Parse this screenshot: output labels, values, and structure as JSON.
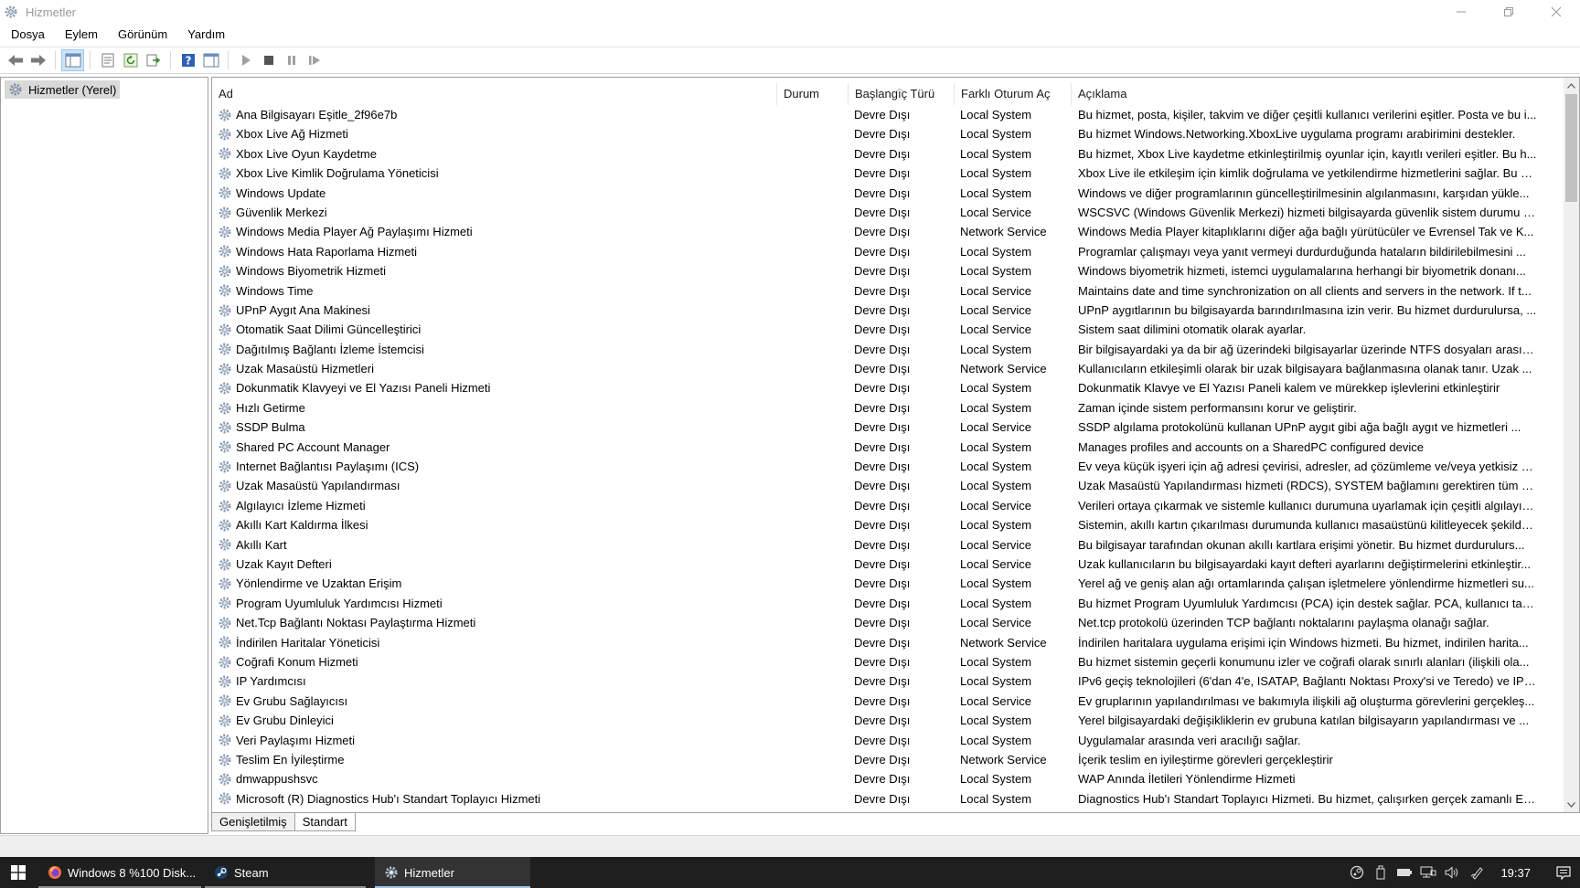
{
  "window": {
    "title": "Hizmetler"
  },
  "menu": [
    "Dosya",
    "Eylem",
    "Görünüm",
    "Yardım"
  ],
  "toolbar_icons": [
    "back-arrow-icon",
    "forward-arrow-icon",
    "console-tree-icon",
    "properties-icon",
    "refresh-icon",
    "export-list-icon",
    "help-icon",
    "show-hide-pane-icon",
    "start-service-icon",
    "stop-service-icon",
    "pause-service-icon",
    "restart-service-icon"
  ],
  "tree": {
    "root_label": "Hizmetler (Yerel)"
  },
  "columns": {
    "name": "Ad",
    "status": "Durum",
    "startup": "Başlangıç Türü",
    "logon": "Farklı Oturum Aç",
    "description": "Açıklama"
  },
  "services": [
    {
      "name": "Ana Bilgisayarı Eşitle_2f96e7b",
      "status": "",
      "startup": "Devre Dışı",
      "logon": "Local System",
      "description": "Bu hizmet, posta, kişiler, takvim ve diğer çeşitli kullanıcı verilerini eşitler. Posta ve bu i..."
    },
    {
      "name": "Xbox Live Ağ Hizmeti",
      "status": "",
      "startup": "Devre Dışı",
      "logon": "Local System",
      "description": "Bu hizmet Windows.Networking.XboxLive uygulama programı arabirimini destekler."
    },
    {
      "name": "Xbox Live Oyun Kaydetme",
      "status": "",
      "startup": "Devre Dışı",
      "logon": "Local System",
      "description": "Bu hizmet, Xbox Live kaydetme etkinleştirilmiş oyunlar için, kayıtlı verileri eşitler. Bu h..."
    },
    {
      "name": "Xbox Live Kimlik Doğrulama Yöneticisi",
      "status": "",
      "startup": "Devre Dışı",
      "logon": "Local System",
      "description": "Xbox Live ile etkileşim için kimlik doğrulama ve yetkilendirme hizmetlerini sağlar. Bu h..."
    },
    {
      "name": "Windows Update",
      "status": "",
      "startup": "Devre Dışı",
      "logon": "Local System",
      "description": "Windows ve diğer programlarının güncelleştirilmesinin algılanmasını, karşıdan yükle..."
    },
    {
      "name": "Güvenlik Merkezi",
      "status": "",
      "startup": "Devre Dışı",
      "logon": "Local Service",
      "description": "WSCSVC (Windows Güvenlik Merkezi) hizmeti bilgisayarda güvenlik sistem durumu a..."
    },
    {
      "name": "Windows Media Player Ağ Paylaşımı Hizmeti",
      "status": "",
      "startup": "Devre Dışı",
      "logon": "Network Service",
      "description": "Windows Media Player kitaplıklarını diğer ağa bağlı yürütücüler ve Evrensel Tak ve K..."
    },
    {
      "name": "Windows Hata Raporlama Hizmeti",
      "status": "",
      "startup": "Devre Dışı",
      "logon": "Local System",
      "description": "Programlar çalışmayı veya yanıt vermeyi durdurduğunda hataların bildirilebilmesini ..."
    },
    {
      "name": "Windows Biyometrik Hizmeti",
      "status": "",
      "startup": "Devre Dışı",
      "logon": "Local System",
      "description": "Windows biyometrik hizmeti, istemci uygulamalarına herhangi bir biyometrik donanı..."
    },
    {
      "name": "Windows Time",
      "status": "",
      "startup": "Devre Dışı",
      "logon": "Local Service",
      "description": "Maintains date and time synchronization on all clients and servers in the network. If t..."
    },
    {
      "name": "UPnP Aygıt Ana Makinesi",
      "status": "",
      "startup": "Devre Dışı",
      "logon": "Local Service",
      "description": "UPnP aygıtlarının bu bilgisayarda barındırılmasına izin verir. Bu hizmet durdurulursa, ..."
    },
    {
      "name": "Otomatik Saat Dilimi Güncelleştirici",
      "status": "",
      "startup": "Devre Dışı",
      "logon": "Local Service",
      "description": "Sistem saat dilimini otomatik olarak ayarlar."
    },
    {
      "name": "Dağıtılmış Bağlantı İzleme İstemcisi",
      "status": "",
      "startup": "Devre Dışı",
      "logon": "Local System",
      "description": "Bir bilgisayardaki ya da bir ağ üzerindeki bilgisayarlar üzerinde NTFS dosyaları arasın..."
    },
    {
      "name": "Uzak Masaüstü Hizmetleri",
      "status": "",
      "startup": "Devre Dışı",
      "logon": "Network Service",
      "description": "Kullanıcıların etkileşimli olarak bir uzak bilgisayara bağlanmasına olanak tanır. Uzak ..."
    },
    {
      "name": "Dokunmatik Klavyeyi ve El Yazısı Paneli Hizmeti",
      "status": "",
      "startup": "Devre Dışı",
      "logon": "Local System",
      "description": "Dokunmatik Klavye ve El Yazısı Paneli kalem ve mürekkep işlevlerini etkinleştirir"
    },
    {
      "name": "Hızlı Getirme",
      "status": "",
      "startup": "Devre Dışı",
      "logon": "Local System",
      "description": "Zaman içinde sistem performansını korur ve geliştirir."
    },
    {
      "name": "SSDP Bulma",
      "status": "",
      "startup": "Devre Dışı",
      "logon": "Local Service",
      "description": "SSDP algılama protokolünü kullanan UPnP aygıt gibi ağa bağlı aygıt ve hizmetleri ..."
    },
    {
      "name": "Shared PC Account Manager",
      "status": "",
      "startup": "Devre Dışı",
      "logon": "Local System",
      "description": "Manages profiles and accounts on a SharedPC configured device"
    },
    {
      "name": "Internet Bağlantısı Paylaşımı (ICS)",
      "status": "",
      "startup": "Devre Dışı",
      "logon": "Local System",
      "description": "Ev veya küçük işyeri için ağ adresi çevirisi, adresler, ad çözümleme ve/veya yetkisiz eri..."
    },
    {
      "name": "Uzak Masaüstü Yapılandırması",
      "status": "",
      "startup": "Devre Dışı",
      "logon": "Local System",
      "description": "Uzak Masaüstü Yapılandırması hizmeti (RDCS), SYSTEM bağlamını gerektiren tüm Uza..."
    },
    {
      "name": "Algılayıcı İzleme Hizmeti",
      "status": "",
      "startup": "Devre Dışı",
      "logon": "Local Service",
      "description": "Verileri ortaya çıkarmak ve sistemle kullanıcı durumuna uyarlamak için çeşitli algılayıc..."
    },
    {
      "name": "Akıllı Kart Kaldırma İlkesi",
      "status": "",
      "startup": "Devre Dışı",
      "logon": "Local System",
      "description": "Sistemin, akıllı kartın çıkarılması durumunda kullanıcı masaüstünü kilitleyecek şekilde..."
    },
    {
      "name": "Akıllı Kart",
      "status": "",
      "startup": "Devre Dışı",
      "logon": "Local Service",
      "description": "Bu bilgisayar tarafından okunan akıllı kartlara erişimi yönetir. Bu hizmet durdurulurs..."
    },
    {
      "name": "Uzak Kayıt Defteri",
      "status": "",
      "startup": "Devre Dışı",
      "logon": "Local Service",
      "description": "Uzak kullanıcıların bu bilgisayardaki kayıt defteri ayarlarını değiştirmelerini etkinleştir..."
    },
    {
      "name": "Yönlendirme ve Uzaktan Erişim",
      "status": "",
      "startup": "Devre Dışı",
      "logon": "Local System",
      "description": "Yerel ağ ve geniş alan ağı ortamlarında çalışan işletmelere yönlendirme hizmetleri su..."
    },
    {
      "name": "Program Uyumluluk Yardımcısı Hizmeti",
      "status": "",
      "startup": "Devre Dışı",
      "logon": "Local System",
      "description": "Bu hizmet Program Uyumluluk Yardımcısı (PCA) için destek sağlar. PCA, kullanıcı tarafı..."
    },
    {
      "name": "Net.Tcp Bağlantı Noktası Paylaştırma Hizmeti",
      "status": "",
      "startup": "Devre Dışı",
      "logon": "Local Service",
      "description": "Net.tcp protokolü üzerinden TCP bağlantı noktalarını paylaşma olanağı sağlar."
    },
    {
      "name": "İndirilen Haritalar Yöneticisi",
      "status": "",
      "startup": "Devre Dışı",
      "logon": "Network Service",
      "description": "İndirilen haritalara uygulama erişimi için Windows hizmeti. Bu hizmet, indirilen harita..."
    },
    {
      "name": "Coğrafi Konum Hizmeti",
      "status": "",
      "startup": "Devre Dışı",
      "logon": "Local System",
      "description": "Bu hizmet sistemin geçerli konumunu izler ve coğrafi olarak sınırlı alanları (ilişkili ola..."
    },
    {
      "name": "IP Yardımcısı",
      "status": "",
      "startup": "Devre Dışı",
      "logon": "Local System",
      "description": "IPv6 geçiş teknolojileri (6'dan 4'e, ISATAP, Bağlantı Noktası Proxy'si ve Teredo) ve IP-H..."
    },
    {
      "name": "Ev Grubu Sağlayıcısı",
      "status": "",
      "startup": "Devre Dışı",
      "logon": "Local Service",
      "description": "Ev gruplarının yapılandırılması ve bakımıyla ilişkili ağ oluşturma görevlerini gerçekleş..."
    },
    {
      "name": "Ev Grubu Dinleyici",
      "status": "",
      "startup": "Devre Dışı",
      "logon": "Local System",
      "description": "Yerel bilgisayardaki değişikliklerin ev grubuna katılan bilgisayarın yapılandırması ve ..."
    },
    {
      "name": "Veri Paylaşımı Hizmeti",
      "status": "",
      "startup": "Devre Dışı",
      "logon": "Local System",
      "description": "Uygulamalar arasında veri aracılığı sağlar."
    },
    {
      "name": "Teslim En İyileştirme",
      "status": "",
      "startup": "Devre Dışı",
      "logon": "Network Service",
      "description": "İçerik teslim en iyileştirme görevleri gerçekleştirir"
    },
    {
      "name": "dmwappushsvc",
      "status": "",
      "startup": "Devre Dışı",
      "logon": "Local System",
      "description": "WAP Anında İletileri Yönlendirme Hizmeti"
    },
    {
      "name": "Microsoft (R) Diagnostics Hub'ı Standart Toplayıcı Hizmeti",
      "status": "",
      "startup": "Devre Dışı",
      "logon": "Local System",
      "description": "Diagnostics Hub'ı Standart Toplayıcı Hizmeti. Bu hizmet, çalışırken gerçek zamanlı ET..."
    }
  ],
  "tabs": [
    "Genişletilmiş",
    "Standart"
  ],
  "taskbar": {
    "tasks": [
      {
        "label": "Windows 8 %100 Disk...",
        "icon": "firefox-icon"
      },
      {
        "label": "Steam",
        "icon": "steam-icon"
      },
      {
        "label": "Hizmetler",
        "icon": "services-gear-icon"
      }
    ],
    "clock": "19:37"
  }
}
